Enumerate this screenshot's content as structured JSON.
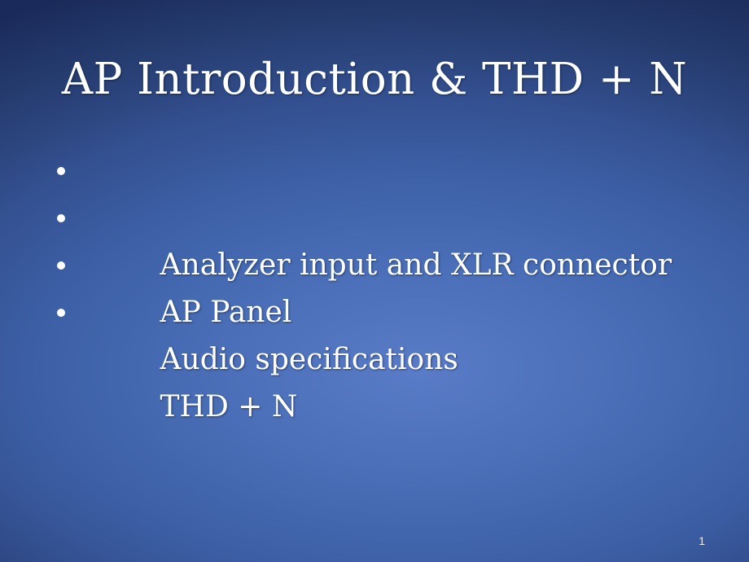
{
  "slide": {
    "title": "AP Introduction & THD + N",
    "bullets": [
      {
        "marker": "bullet-dot",
        "text": "Analyzer input and XLR connector"
      },
      {
        "marker": "bullet-dot",
        "text": "AP Panel"
      },
      {
        "marker": "bullet-dot",
        "text": "Audio specifications"
      },
      {
        "marker": "bullet-dot",
        "text": "THD + N"
      }
    ],
    "page_number": "1",
    "colors": {
      "background_dark": "#1a2a66",
      "background_mid": "#3c5ea4",
      "background_light": "#5a7cc8",
      "corner_shadow": "#0d1630",
      "text": "#ffffff",
      "page_number_text": "#e8ecf7"
    }
  }
}
